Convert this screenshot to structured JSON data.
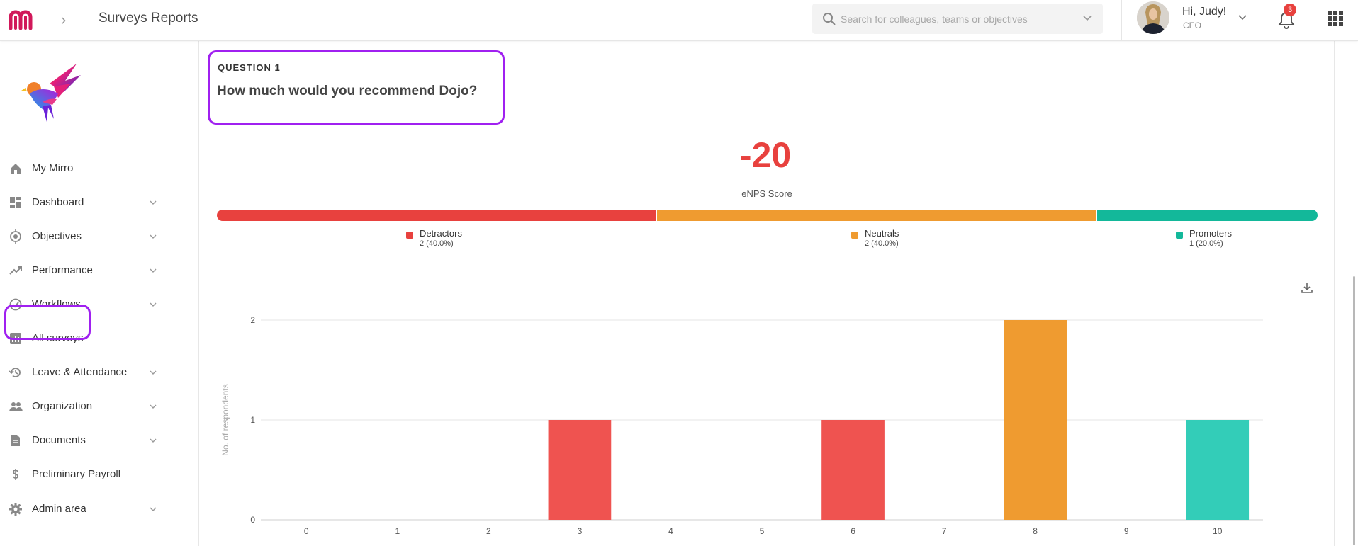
{
  "header": {
    "page_title": "Surveys Reports",
    "search_placeholder": "Search for colleagues, teams or objectives",
    "greeting": "Hi, Judy!",
    "role": "CEO",
    "notification_count": "3",
    "brand_color": "#d1185a"
  },
  "sidebar": {
    "items": [
      {
        "label": "My Mirro",
        "icon": "home-icon",
        "has_caret": false
      },
      {
        "label": "Dashboard",
        "icon": "dashboard-icon",
        "has_caret": true
      },
      {
        "label": "Objectives",
        "icon": "target-icon",
        "has_caret": true
      },
      {
        "label": "Performance",
        "icon": "trending-up-icon",
        "has_caret": true
      },
      {
        "label": "Workflows",
        "icon": "check-circle-icon",
        "has_caret": true
      },
      {
        "label": "All surveys",
        "icon": "bar-chart-icon",
        "has_caret": false,
        "highlighted": true
      },
      {
        "label": "Leave & Attendance",
        "icon": "history-icon",
        "has_caret": true
      },
      {
        "label": "Organization",
        "icon": "people-icon",
        "has_caret": true
      },
      {
        "label": "Documents",
        "icon": "document-icon",
        "has_caret": true
      },
      {
        "label": "Preliminary Payroll",
        "icon": "dollar-icon",
        "has_caret": false
      },
      {
        "label": "Admin area",
        "icon": "gear-icon",
        "has_caret": true
      }
    ]
  },
  "question": {
    "label": "QUESTION 1",
    "text": "How much would you recommend Dojo?"
  },
  "enps": {
    "score": "-20",
    "score_label": "eNPS Score",
    "segments": [
      {
        "name": "Detractors",
        "value": "2 (40.0%)",
        "fraction": 0.4,
        "color": "#e8413e"
      },
      {
        "name": "Neutrals",
        "value": "2 (40.0%)",
        "fraction": 0.4,
        "color": "#ef9b30"
      },
      {
        "name": "Promoters",
        "value": "1 (20.0%)",
        "fraction": 0.2,
        "color": "#13b89a"
      }
    ]
  },
  "chart_data": {
    "type": "bar",
    "categories": [
      "0",
      "1",
      "2",
      "3",
      "4",
      "5",
      "6",
      "7",
      "8",
      "9",
      "10"
    ],
    "values": [
      0,
      0,
      0,
      1,
      0,
      0,
      1,
      0,
      2,
      0,
      1
    ],
    "bar_colors": [
      "#ef5350",
      "#ef5350",
      "#ef5350",
      "#ef5350",
      "#ef5350",
      "#ef5350",
      "#ef5350",
      "#ef9b30",
      "#ef9b30",
      "#33cdb8",
      "#33cdb8"
    ],
    "ylabel": "No. of respondents",
    "xlabel": "",
    "ylim": [
      0,
      2
    ],
    "yticks": [
      0,
      1,
      2
    ],
    "grid": true
  }
}
